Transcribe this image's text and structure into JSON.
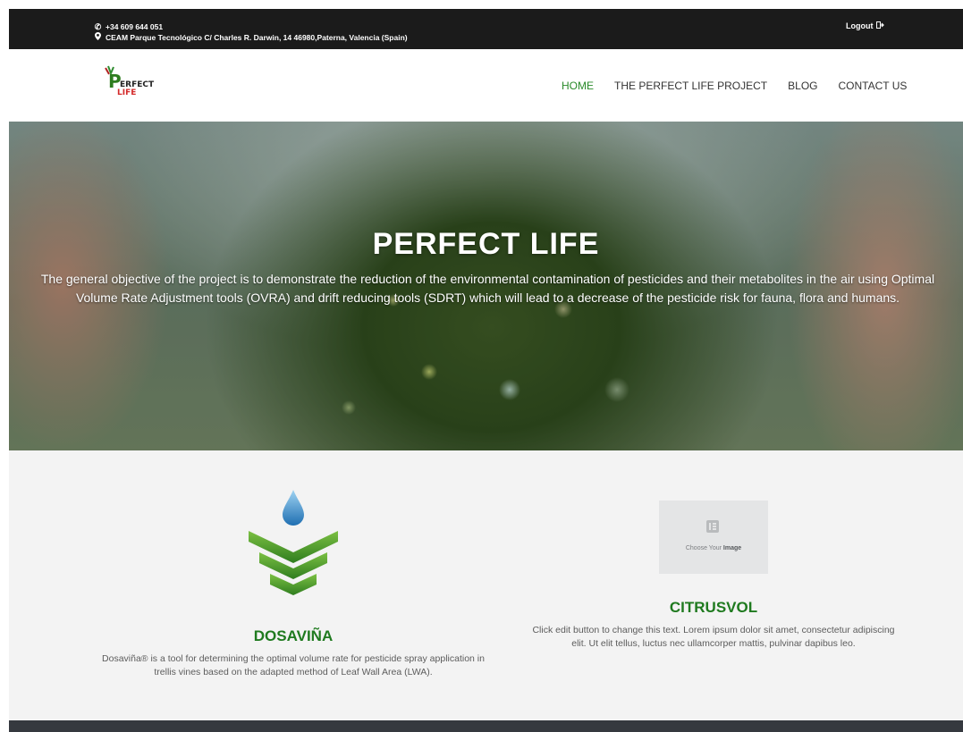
{
  "topbar": {
    "phone": "+34 609 644 051",
    "address": "CEAM Parque Tecnológico C/ Charles R. Darwin, 14 46980,Paterna, Valencia (Spain)",
    "logout_label": "Logout",
    "icons": [
      "phone-icon",
      "map-marker-icon",
      "sign-out-icon"
    ]
  },
  "logo": {
    "text_line1": "ERFECT",
    "text_line2": "LIFE"
  },
  "nav": {
    "items": [
      {
        "label": "HOME",
        "active": true
      },
      {
        "label": "THE PERFECT LIFE PROJECT",
        "active": false
      },
      {
        "label": "BLOG",
        "active": false
      },
      {
        "label": "CONTACT US",
        "active": false
      }
    ]
  },
  "hero": {
    "title": "PERFECT LIFE",
    "description": "The general objective of the project is to demonstrate the reduction of the environmental contamination of pesticides and their metabolites in the air using Optimal Volume Rate Adjustment tools (OVRA) and drift reducing tools (SDRT) which will lead to a decrease of the pesticide risk for fauna, flora and humans."
  },
  "features": {
    "left": {
      "title": "DOSAVIÑA",
      "description": "Dosaviña® is a tool for determining the optimal volume rate for pesticide spray application in trellis vines based on the adapted method of Leaf Wall Area (LWA)."
    },
    "right": {
      "placeholder_prefix": "Choose Your ",
      "placeholder_bold": "Image",
      "title": "CITRUSVOL",
      "description": "Click edit button to change this text. Lorem ipsum dolor sit amet, consectetur adipiscing elit. Ut elit tellus, luctus nec ullamcorper mattis, pulvinar dapibus leo."
    }
  },
  "colors": {
    "accent_green": "#2a8a2a",
    "title_green": "#1f7a1f",
    "topbar_bg": "#1b1b1b",
    "footer_bg": "#35393f"
  }
}
